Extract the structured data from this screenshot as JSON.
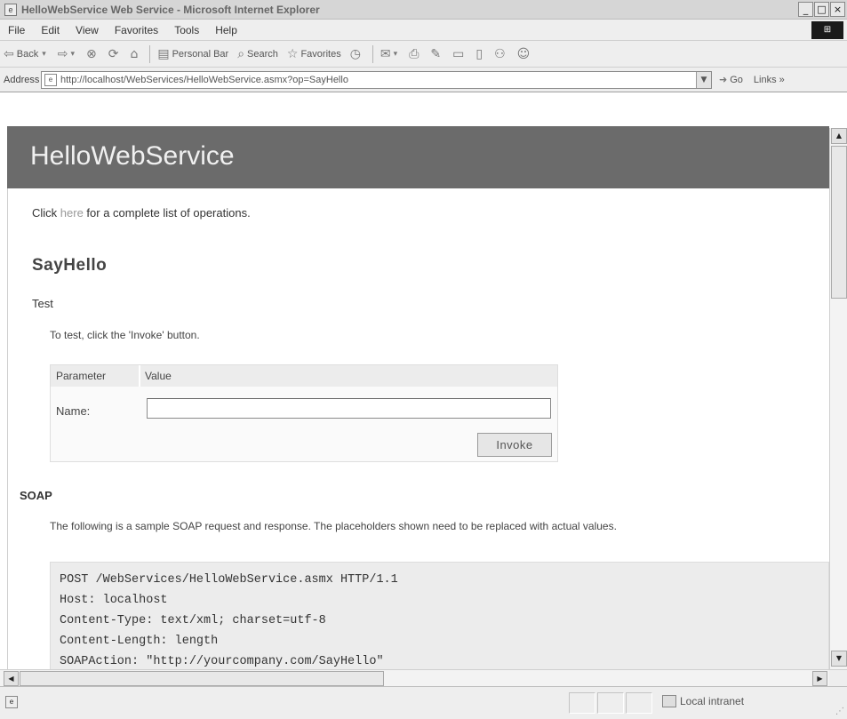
{
  "window": {
    "title": "HelloWebService Web Service - Microsoft Internet Explorer",
    "minimize": "_",
    "maximize": "□",
    "close": "×"
  },
  "menu": [
    "File",
    "Edit",
    "View",
    "Favorites",
    "Tools",
    "Help"
  ],
  "toolbar": {
    "back": "Back",
    "personal_bar": "Personal Bar",
    "search": "Search",
    "favorites": "Favorites"
  },
  "address": {
    "label": "Address",
    "url": "http://localhost/WebServices/HelloWebService.asmx?op=SayHello",
    "go": "Go",
    "links": "Links »"
  },
  "page": {
    "header": "HelloWebService",
    "ops_prefix": "Click ",
    "ops_link": "here",
    "ops_suffix": " for a complete list of operations.",
    "operation": "SayHello",
    "test_heading": "Test",
    "test_desc": "To test, click the 'Invoke' button.",
    "param_col": "Parameter",
    "value_col": "Value",
    "param_name": "Name:",
    "param_value": "",
    "invoke": "Invoke",
    "soap_heading": "SOAP",
    "soap_desc": "The following is a sample SOAP request and response. The placeholders shown need to be replaced with actual values.",
    "code": [
      "POST /WebServices/HelloWebService.asmx HTTP/1.1",
      "Host: localhost",
      "Content-Type: text/xml; charset=utf-8",
      "Content-Length: length",
      "SOAPAction: \"http://yourcompany.com/SayHello\""
    ]
  },
  "status": {
    "zone": "Local intranet"
  },
  "colors": {
    "header_bg": "#6b6b6b",
    "link": "#999999"
  }
}
